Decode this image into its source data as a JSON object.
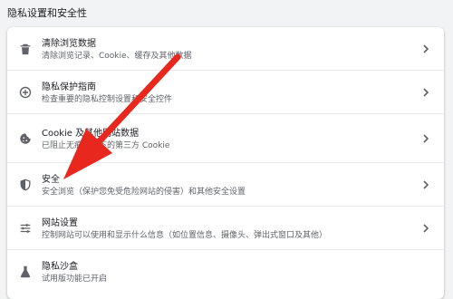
{
  "section": {
    "title": "隐私设置和安全性"
  },
  "rows": [
    {
      "icon": "trash-icon",
      "title": "清除浏览数据",
      "desc": "清除浏览记录、Cookie、缓存及其他数据"
    },
    {
      "icon": "privacy-guide-icon",
      "title": "隐私保护指南",
      "desc": "检查重要的隐私控制设置和安全控件"
    },
    {
      "icon": "cookie-icon",
      "title": "Cookie 及其他网站数据",
      "desc": "已阻止无痕模式下的第三方 Cookie"
    },
    {
      "icon": "shield-icon",
      "title": "安全",
      "desc": "安全浏览（保护您免受危险网站的侵害）和其他安全设置"
    },
    {
      "icon": "sliders-icon",
      "title": "网站设置",
      "desc": "控制网站可以使用和显示什么信息（如位置信息、摄像头、弹出式窗口及其他）"
    },
    {
      "icon": "flask-icon",
      "title": "隐私沙盒",
      "desc": "试用版功能已开启"
    }
  ],
  "colors": {
    "arrow": "#e8281e",
    "background": "#f1f3f4",
    "card": "#ffffff"
  }
}
